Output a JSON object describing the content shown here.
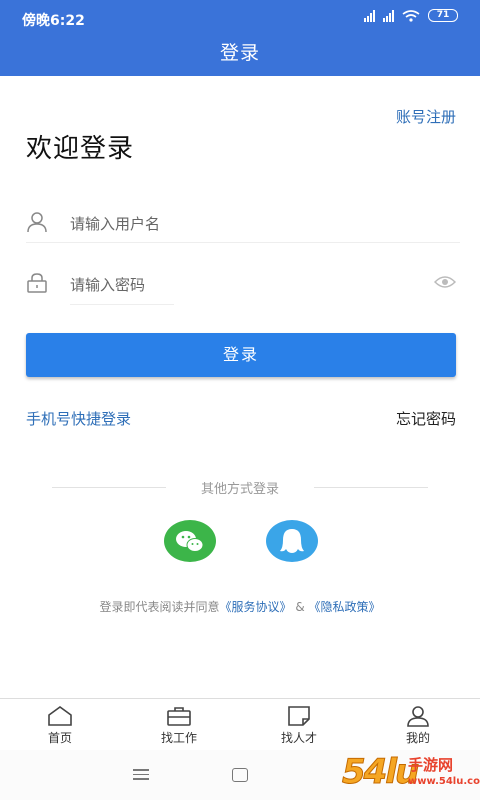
{
  "status_bar": {
    "time": "傍晚6:22",
    "battery": "71"
  },
  "header": {
    "title": "登录"
  },
  "register_link": "账号注册",
  "welcome_title": "欢迎登录",
  "username_field": {
    "placeholder": "请输入用户名",
    "icon": "user-icon"
  },
  "password_field": {
    "placeholder": "请输入密码",
    "icon": "lock-icon",
    "toggle_icon": "eye-icon"
  },
  "login_button": "登录",
  "phone_login_link": "手机号快捷登录",
  "forgot_password_link": "忘记密码",
  "other_login": {
    "label": "其他方式登录",
    "options": [
      {
        "name": "wechat",
        "icon": "wechat-icon",
        "color": "#3cb549"
      },
      {
        "name": "qq",
        "icon": "qq-icon",
        "color": "#3aa5e8"
      }
    ]
  },
  "agreement": {
    "prefix": "登录即代表阅读并同意",
    "service_link": "《服务协议》",
    "joiner": " & ",
    "privacy_link": "《隐私政策》"
  },
  "tabbar": {
    "items": [
      {
        "label": "首页",
        "icon": "home-icon"
      },
      {
        "label": "找工作",
        "icon": "briefcase-icon"
      },
      {
        "label": "找人才",
        "icon": "note-icon"
      },
      {
        "label": "我的",
        "icon": "profile-icon"
      }
    ]
  },
  "watermark": {
    "number": "54lu",
    "text": "手游网",
    "url": "www.54lu.com"
  },
  "colors": {
    "primary": "#3a73d9",
    "button": "#2a80e8",
    "link": "#2f6fb8"
  }
}
